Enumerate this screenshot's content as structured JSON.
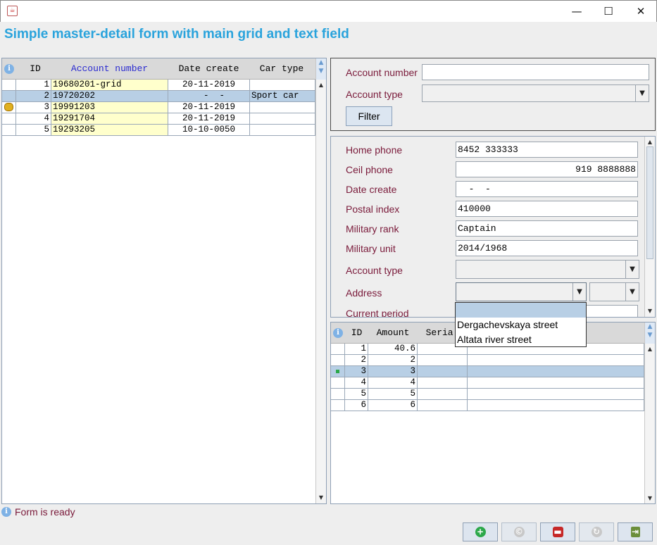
{
  "window": {
    "app_icon": "java-icon",
    "minimize": "—",
    "maximize": "☐",
    "close": "✕"
  },
  "heading": "Simple master-detail form with main grid and text field",
  "master_grid": {
    "columns": [
      "ID",
      "Account number",
      "Date create",
      "Car type"
    ],
    "rows": [
      {
        "id": "1",
        "account": "19680201-grid",
        "date": "20-11-2019",
        "car": "",
        "selected": false,
        "locked": false
      },
      {
        "id": "2",
        "account": "19720202",
        "date": "  -  -",
        "car": "Sport car",
        "selected": true,
        "locked": false
      },
      {
        "id": "3",
        "account": "19991203",
        "date": "20-11-2019",
        "car": "",
        "selected": false,
        "locked": true
      },
      {
        "id": "4",
        "account": "19291704",
        "date": "20-11-2019",
        "car": "",
        "selected": false,
        "locked": false
      },
      {
        "id": "5",
        "account": "19293205",
        "date": "10-10-0050",
        "car": "",
        "selected": false,
        "locked": false
      }
    ]
  },
  "filter": {
    "account_number_label": "Account number",
    "account_number_value": "",
    "account_type_label": "Account type",
    "account_type_value": "",
    "filter_button": "Filter"
  },
  "details": {
    "home_phone_label": "Home phone",
    "home_phone": "8452 333333",
    "cell_phone_label": "Ceil phone",
    "cell_phone": "919 8888888",
    "date_create_label": "Date create",
    "date_create": "  -  -",
    "postal_index_label": "Postal index",
    "postal_index": "410000",
    "military_rank_label": "Military rank",
    "military_rank": "Captain",
    "military_unit_label": "Military unit",
    "military_unit": "2014/1968",
    "account_type_label": "Account type",
    "account_type": "",
    "address_label": "Address",
    "address": "",
    "address_num": "",
    "current_period_label": "Current period",
    "address_options": [
      "",
      "Dergachevskaya street",
      "Altata river street"
    ]
  },
  "detail_grid": {
    "columns": [
      "ID",
      "Amount",
      "Seria."
    ],
    "rows": [
      {
        "id": "1",
        "amount": "40.6",
        "seria": ""
      },
      {
        "id": "2",
        "amount": "2",
        "seria": ""
      },
      {
        "id": "3",
        "amount": "3",
        "seria": ""
      },
      {
        "id": "4",
        "amount": "4",
        "seria": ""
      },
      {
        "id": "5",
        "amount": "5",
        "seria": ""
      },
      {
        "id": "6",
        "amount": "6",
        "seria": ""
      }
    ],
    "selected_row": 3
  },
  "status": {
    "text": "Form is ready"
  },
  "toolbar": {
    "icons": [
      "add-icon",
      "copy-icon",
      "delete-icon",
      "refresh-icon",
      "exit-icon"
    ]
  },
  "colors": {
    "heading": "#29a3dc",
    "label": "#7a1a3a",
    "selection": "#b8cfe5",
    "highlight": "#ffffcc"
  }
}
